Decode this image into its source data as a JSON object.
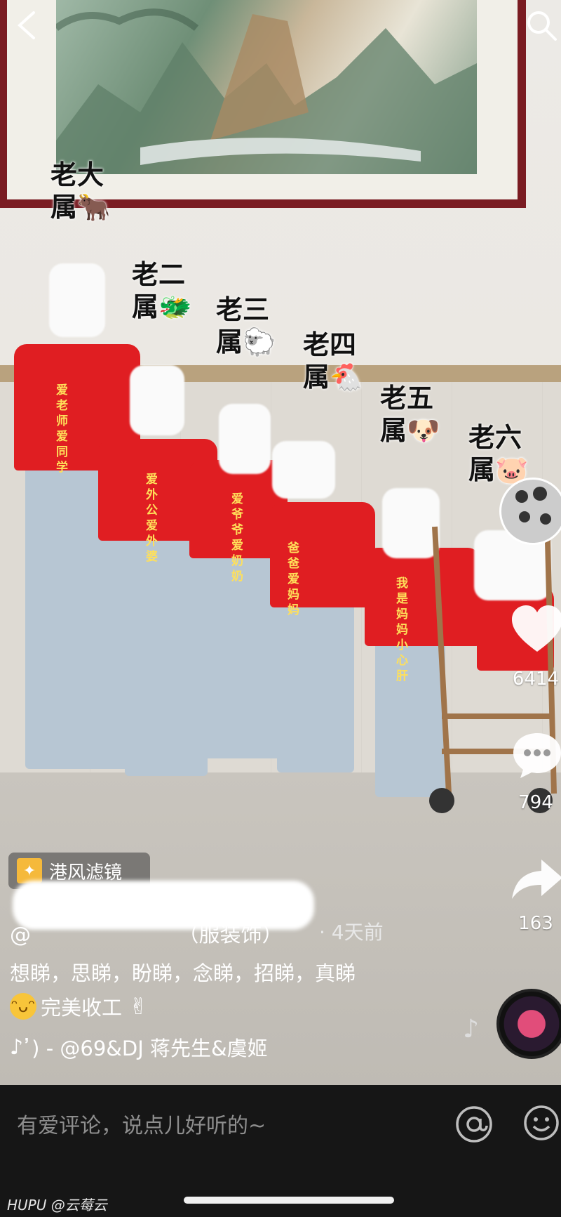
{
  "labels": [
    {
      "rank": "老大",
      "zodiac": "属",
      "animal_icon": "ox-emoji"
    },
    {
      "rank": "老二",
      "zodiac": "属",
      "animal_icon": "dragon-emoji"
    },
    {
      "rank": "老三",
      "zodiac": "属",
      "animal_icon": "sheep-emoji"
    },
    {
      "rank": "老四",
      "zodiac": "属",
      "animal_icon": "rooster-emoji"
    },
    {
      "rank": "老五",
      "zodiac": "属",
      "animal_icon": "dog-emoji"
    },
    {
      "rank": "老六",
      "zodiac": "属",
      "animal_icon": "pig-emoji"
    }
  ],
  "animal_glyphs": {
    "ox-emoji": "🐂",
    "dragon-emoji": "🐲",
    "sheep-emoji": "🐑",
    "rooster-emoji": "🐔",
    "dog-emoji": "🐶",
    "pig-emoji": "🐷"
  },
  "shirt_slogans": [
    {
      "line1": "爱老师",
      "line2": "爱同学"
    },
    {
      "line1": "爱外公",
      "line2": "爱外婆"
    },
    {
      "line1": "爱爷爷",
      "line2": "爱奶奶"
    },
    {
      "line1": "爸爸",
      "line2": "爱妈妈"
    },
    {
      "line1": "我是妈妈",
      "line2": "小心肝"
    }
  ],
  "filter_tag": {
    "label": "港风滤镜",
    "icon": "filter-icon"
  },
  "post": {
    "author": "@",
    "author_suffix": "（服装饰）",
    "time": "· 4天前",
    "description_line1": "想睇，思睇，盼睇，念睇，招睇，真睇",
    "description_line2": "完美收工",
    "music": "̓) - @69&DJ 蒋先生&虞姬"
  },
  "side_actions": {
    "like_count": "6414",
    "comment_count": "794",
    "share_count": "163"
  },
  "bottom_bar": {
    "comment_placeholder": "有爱评论，说点儿好听的~"
  },
  "watermark": "HUPU @云莓云",
  "colors": {
    "shirt": "#e01e22",
    "frame": "#7a1c22",
    "bottom_bar": "#161616"
  }
}
